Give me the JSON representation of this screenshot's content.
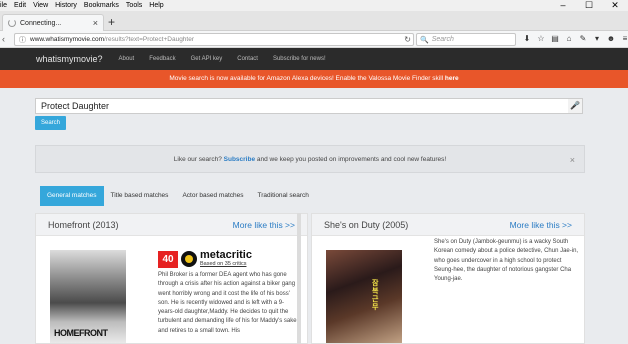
{
  "menubar": {
    "items": [
      "ile",
      "Edit",
      "View",
      "History",
      "Bookmarks",
      "Tools",
      "Help"
    ],
    "window_controls": [
      "–",
      "☐",
      "✕"
    ]
  },
  "tab": {
    "title": "Connecting...",
    "close": "×",
    "new_tab": "+"
  },
  "navbar": {
    "back": "‹",
    "info": "ⓘ",
    "url_host": "www.whatismymovie.com",
    "url_path": "/results?text=Protect+Daughter",
    "reload": "↻",
    "search_placeholder": "Search",
    "search_icon": "🔍"
  },
  "toolbar_icons": [
    {
      "name": "download-icon",
      "glyph": "⬇"
    },
    {
      "name": "bookmark-star-icon",
      "glyph": "☆"
    },
    {
      "name": "library-icon",
      "glyph": "▤"
    },
    {
      "name": "home-icon",
      "glyph": "⌂"
    },
    {
      "name": "pen-icon",
      "glyph": "✎"
    },
    {
      "name": "chevron-down-icon",
      "glyph": "▾"
    },
    {
      "name": "account-icon",
      "glyph": "☻"
    },
    {
      "name": "menu-icon",
      "glyph": "≡"
    }
  ],
  "site": {
    "logo": "whatismymovie?",
    "nav": [
      "About",
      "Feedback",
      "Get API key",
      "Contact",
      "Subscribe for news!"
    ]
  },
  "alert": {
    "text": "Movie search is now available for Amazon Alexa devices! Enable the Valossa Movie Finder skill ",
    "link": "here"
  },
  "search": {
    "value": "Protect Daughter",
    "button": "Search",
    "mic": "🎤"
  },
  "subscribe_box": {
    "before": "Like our search? ",
    "link": "Subscribe",
    "after": " and we keep you posted on improvements and cool new features!",
    "close": "×"
  },
  "match_tabs": [
    "General matches",
    "Title based matches",
    "Actor based matches",
    "Traditional search"
  ],
  "results": [
    {
      "title": "Homefront (2013)",
      "more": "More like this >>",
      "poster_text": "HOMEFRONT",
      "metascore": "40",
      "metacritic": "metacritic",
      "critics": "Based on 35 critics",
      "plot": "Phil Broker is a former DEA agent who has gone through a crisis after his action against a biker gang went horribly wrong and it cost the life of his boss' son. He is recently widowed and is left with a 9-years-old daughter,Maddy. He decides to quit the turbulent and demanding life of his for Maddy's sake and retires to a small town. His"
    },
    {
      "title": "She's on Duty (2005)",
      "more": "More like this >>",
      "poster_text": "잠복근무",
      "plot": "She's on Duty (Jambok-geunmu) is a wacky South Korean comedy about a police detective, Chun Jae-in, who goes undercover in a high school to protect Seung-hee, the daughter of notorious gangster Cha Young-jae."
    }
  ]
}
